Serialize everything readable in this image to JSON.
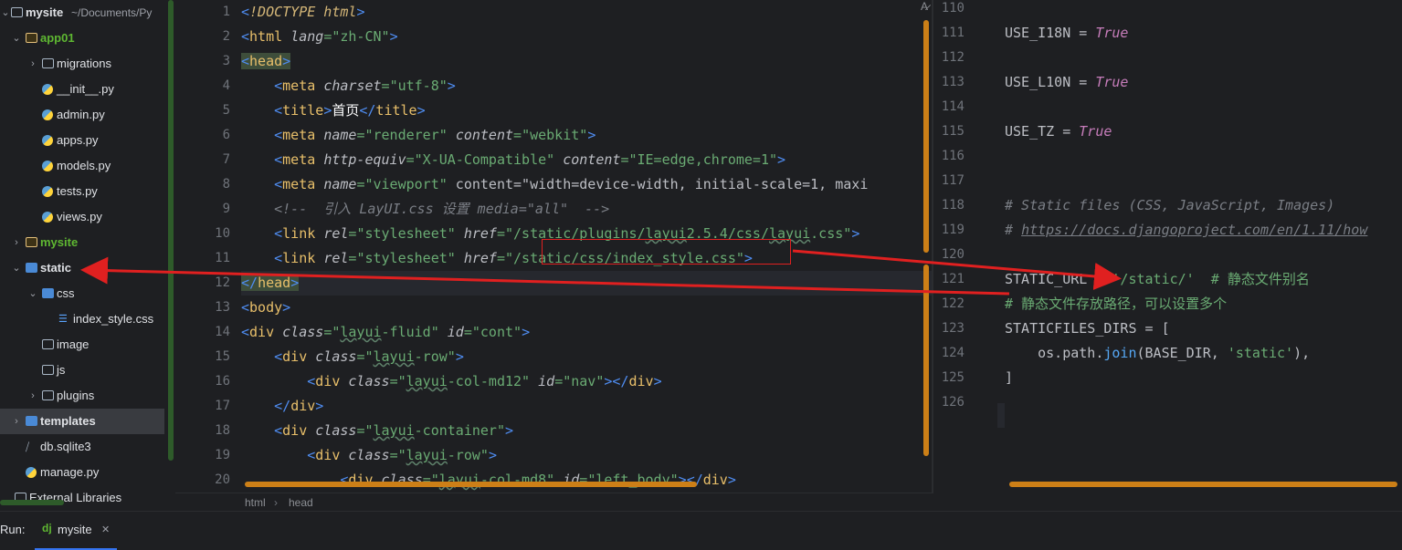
{
  "tree": {
    "root_label": "mysite",
    "root_path": "~/Documents/Py",
    "items": [
      {
        "label": "app01",
        "kind": "folder",
        "depth": 1,
        "expanded": true
      },
      {
        "label": "migrations",
        "kind": "folder",
        "depth": 2,
        "expanded": false
      },
      {
        "label": "__init__.py",
        "kind": "py",
        "depth": 2
      },
      {
        "label": "admin.py",
        "kind": "py",
        "depth": 2
      },
      {
        "label": "apps.py",
        "kind": "py",
        "depth": 2
      },
      {
        "label": "models.py",
        "kind": "py",
        "depth": 2
      },
      {
        "label": "tests.py",
        "kind": "py",
        "depth": 2
      },
      {
        "label": "views.py",
        "kind": "py",
        "depth": 2
      },
      {
        "label": "mysite",
        "kind": "folder",
        "depth": 1,
        "expanded": false
      },
      {
        "label": "static",
        "kind": "folder",
        "depth": 1,
        "expanded": true
      },
      {
        "label": "css",
        "kind": "folder",
        "depth": 2,
        "expanded": true
      },
      {
        "label": "index_style.css",
        "kind": "css",
        "depth": 3
      },
      {
        "label": "image",
        "kind": "folder",
        "depth": 2
      },
      {
        "label": "js",
        "kind": "folder",
        "depth": 2
      },
      {
        "label": "plugins",
        "kind": "folder",
        "depth": 2,
        "expanded": false
      },
      {
        "label": "templates",
        "kind": "folder",
        "depth": 1,
        "expanded": false
      },
      {
        "label": "db.sqlite3",
        "kind": "db",
        "depth": 1
      },
      {
        "label": "manage.py",
        "kind": "py",
        "depth": 1
      },
      {
        "label": "External Libraries",
        "kind": "lib",
        "depth": 0
      }
    ]
  },
  "editor1": {
    "line_numbers": [
      "1",
      "2",
      "3",
      "4",
      "5",
      "6",
      "7",
      "8",
      "9",
      "10",
      "11",
      "12",
      "13",
      "14",
      "15",
      "16",
      "17",
      "18",
      "19",
      "20"
    ],
    "lines": [
      "<!DOCTYPE html>",
      "<html lang=\"zh-CN\">",
      "<head>",
      "    <meta charset=\"utf-8\">",
      "    <title>首页</title>",
      "    <meta name=\"renderer\" content=\"webkit\">",
      "    <meta http-equiv=\"X-UA-Compatible\" content=\"IE=edge,chrome=1\">",
      "    <meta name=\"viewport\" content=\"width=device-width, initial-scale=1, maxi",
      "    <!--  引入 LayUI.css 设置 media=\"all\"  -->",
      "    <link rel=\"stylesheet\" href=\"/static/plugins/layui2.5.4/css/layui.css\">",
      "    <link rel=\"stylesheet\" href=\"/static/css/index_style.css\">",
      "</head>",
      "<body>",
      "<div class=\"layui-fluid\" id=\"cont\">",
      "    <div class=\"layui-row\">",
      "        <div class=\"layui-col-md12\" id=\"nav\"></div>",
      "    </div>",
      "    <div class=\"layui-container\">",
      "        <div class=\"layui-row\">",
      "            <div class=\"layui-col-md8\" id=\"left_body\"></div>"
    ],
    "highlighted_path": "/static/css/index_style.css"
  },
  "breadcrumb": {
    "items": [
      "html",
      "head"
    ]
  },
  "editor2": {
    "line_numbers": [
      "110",
      "111",
      "112",
      "113",
      "114",
      "115",
      "116",
      "117",
      "118",
      "119",
      "120",
      "121",
      "122",
      "123",
      "124",
      "125",
      "126"
    ],
    "lines": [
      "",
      "USE_I18N = True",
      "",
      "USE_L10N = True",
      "",
      "USE_TZ = True",
      "",
      "",
      "# Static files (CSS, JavaScript, Images)",
      "# https://docs.djangoproject.com/en/1.11/how",
      "",
      "STATIC_URL = '/static/'  # 静态文件别名",
      "# 静态文件存放路径，可以设置多个",
      "STATICFILES_DIRS = [",
      "    os.path.join(BASE_DIR, 'static'),",
      "]",
      ""
    ]
  },
  "run": {
    "label": "Run:",
    "tab_icon": "dj",
    "tab_name": "mysite"
  },
  "colors": {
    "accent_arrow": "#e02020",
    "scrollbar": "#cc7f17",
    "selection": "#2e436e"
  }
}
